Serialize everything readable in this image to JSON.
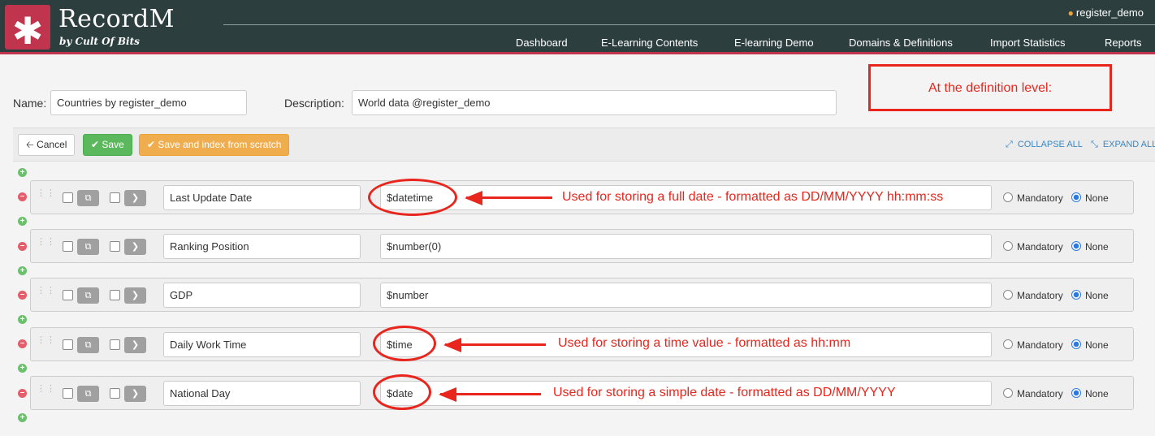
{
  "app": {
    "logo_glyph": "✱",
    "brand": "RecordM",
    "tagline": "by Cult Of Bits",
    "user": "register_demo",
    "accent": "#c0344d",
    "header_bg": "#2d3e3f"
  },
  "nav": {
    "dashboard": "Dashboard",
    "elearning_contents": "E-Learning Contents",
    "elearning_demo": "E-learning Demo",
    "domains": "Domains & Definitions",
    "import_stats": "Import Statistics",
    "reports": "Reports"
  },
  "form": {
    "name_label": "Name:",
    "name_value": "Countries by register_demo",
    "description_label": "Description:",
    "description_value": "World data @register_demo"
  },
  "toolbar": {
    "cancel": "Cancel",
    "save": "Save",
    "save_index": "Save and index from scratch",
    "collapse_all": "COLLAPSE ALL",
    "expand_all": "EXPAND ALL"
  },
  "fields": [
    {
      "name": "Last Update Date",
      "description": "$datetime",
      "mandatory_label": "Mandatory",
      "none_label": "None",
      "selected": "None"
    },
    {
      "name": "Ranking Position",
      "description": "$number(0)",
      "mandatory_label": "Mandatory",
      "none_label": "None",
      "selected": "None"
    },
    {
      "name": "GDP",
      "description": "$number",
      "mandatory_label": "Mandatory",
      "none_label": "None",
      "selected": "None"
    },
    {
      "name": "Daily Work Time",
      "description": "$time",
      "mandatory_label": "Mandatory",
      "none_label": "None",
      "selected": "None"
    },
    {
      "name": "National Day",
      "description": "$date",
      "mandatory_label": "Mandatory",
      "none_label": "None",
      "selected": "None"
    }
  ],
  "annotations": {
    "box": "At the definition level:",
    "datetime": "Used for storing a full date - formatted as DD/MM/YYYY hh:mm:ss",
    "time": "Used for storing a time value - formatted as hh:mm",
    "date": "Used for storing a simple date - formatted as DD/MM/YYYY",
    "color": "#e8261d"
  },
  "icons": {
    "cancel": "arrow-left-icon",
    "save": "check-icon",
    "collapse": "collapse-icon",
    "expand": "expand-icon",
    "copy": "copy-icon",
    "expand_row": "chevron-right-icon",
    "drag": "drag-handle-icon",
    "add": "plus-icon",
    "remove": "minus-icon",
    "user": "person-icon"
  }
}
